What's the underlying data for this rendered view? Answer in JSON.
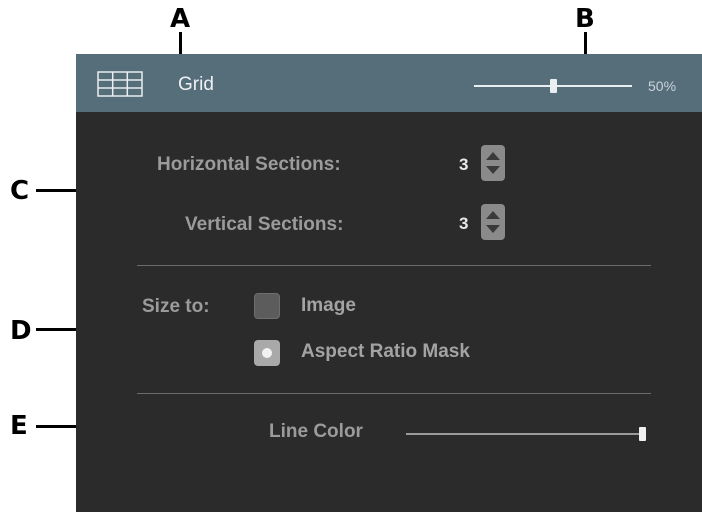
{
  "callouts": {
    "a": "A",
    "b": "B",
    "c": "C",
    "d": "D",
    "e": "E"
  },
  "header": {
    "icon": "grid-icon",
    "title": "Grid",
    "opacity": {
      "value": 0.5,
      "label": "50%"
    }
  },
  "sections": {
    "horizontal": {
      "label": "Horizontal Sections:",
      "value": "3"
    },
    "vertical": {
      "label": "Vertical Sections:",
      "value": "3"
    }
  },
  "size_to": {
    "label": "Size to:",
    "options": [
      {
        "label": "Image",
        "selected": false
      },
      {
        "label": "Aspect Ratio Mask",
        "selected": true
      }
    ]
  },
  "line_color": {
    "label": "Line Color",
    "value": 1.0
  },
  "colors": {
    "header_bg": "#566d7a",
    "panel_bg": "#2b2b2b",
    "label": "#9b9b9b",
    "value": "#e9e9e9"
  }
}
